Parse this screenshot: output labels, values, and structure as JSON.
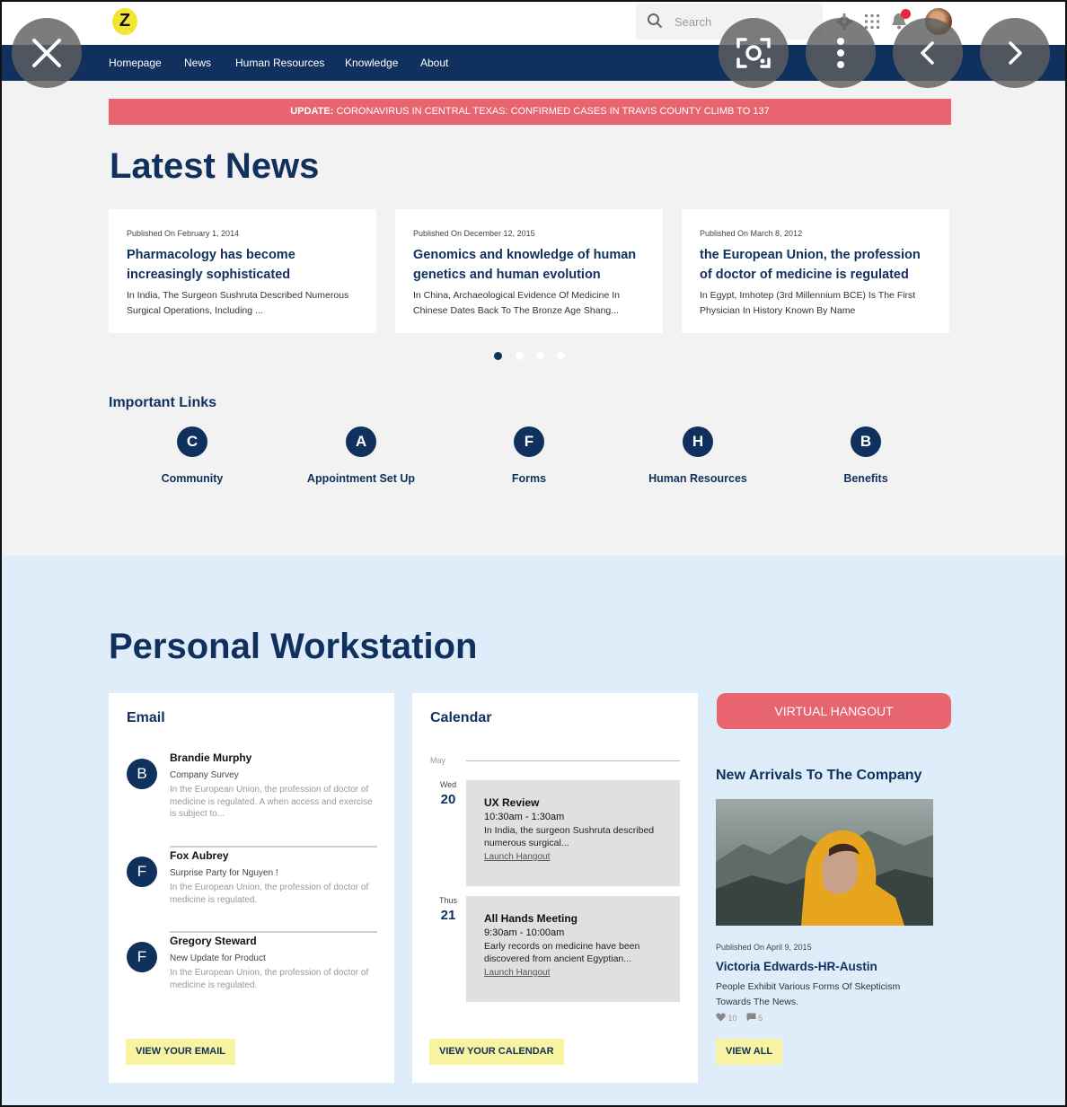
{
  "header": {
    "logo_letter": "Z",
    "search_placeholder": "Search",
    "icons": [
      "search-icon",
      "gear-icon",
      "apps-grid-icon",
      "bell-icon",
      "avatar"
    ]
  },
  "nav": {
    "items": [
      "Homepage",
      "News",
      "Human Resources",
      "Knowledge",
      "About"
    ]
  },
  "viewer_controls": [
    "close-icon",
    "lens-icon",
    "more-vertical-icon",
    "chevron-left-icon",
    "chevron-right-icon"
  ],
  "alert": {
    "label": "UPDATE:",
    "text": "CORONAVIRUS IN CENTRAL TEXAS: CONFIRMED CASES IN TRAVIS COUNTY CLIMB TO 137"
  },
  "latest_news": {
    "heading": "Latest News",
    "cards": [
      {
        "date": "Published On February 1, 2014",
        "title": "Pharmacology has become increasingly sophisticated",
        "excerpt": "In India, The Surgeon Sushruta Described Numerous Surgical Operations, Including ..."
      },
      {
        "date": "Published On December 12, 2015",
        "title": "Genomics and knowledge of human genetics and human evolution",
        "excerpt": "In China, Archaeological Evidence Of Medicine In Chinese Dates Back To The Bronze Age Shang..."
      },
      {
        "date": "Published On March 8, 2012",
        "title": "the European Union, the profession of doctor of medicine is regulated",
        "excerpt": "In Egypt, Imhotep (3rd Millennium BCE) Is The First Physician In History Known By Name"
      }
    ],
    "carousel_active": 1,
    "carousel_total": 4
  },
  "important_links": {
    "heading": "Important Links",
    "items": [
      {
        "letter": "C",
        "label": "Community"
      },
      {
        "letter": "A",
        "label": "Appointment Set Up"
      },
      {
        "letter": "F",
        "label": "Forms"
      },
      {
        "letter": "H",
        "label": "Human Resources"
      },
      {
        "letter": "B",
        "label": "Benefits"
      }
    ]
  },
  "workstation": {
    "heading": "Personal Workstation",
    "email": {
      "title": "Email",
      "messages": [
        {
          "initial": "B",
          "from": "Brandie Murphy",
          "subject": "Company Survey",
          "preview": "In the European Union, the profession of doctor of medicine is regulated. A  when access and exercise is subject to..."
        },
        {
          "initial": "F",
          "from": "Fox Aubrey",
          "subject": "Surprise Party for Nguyen !",
          "preview": "In the European Union, the profession of doctor of medicine is regulated."
        },
        {
          "initial": "F",
          "from": "Gregory Steward",
          "subject": "New Update for Product",
          "preview": "In the European Union, the profession of doctor of medicine is regulated."
        }
      ],
      "cta": "VIEW YOUR EMAIL"
    },
    "calendar": {
      "title": "Calendar",
      "month": "May",
      "days": [
        {
          "dow": "Wed",
          "num": "20",
          "event": {
            "title": "UX Review",
            "time": "10:30am - 1:30am",
            "desc": "In India, the surgeon Sushruta described numerous surgical...",
            "link": "Launch Hangout"
          }
        },
        {
          "dow": "Thus",
          "num": "21",
          "event": {
            "title": "All Hands Meeting",
            "time": "9:30am - 10:00am",
            "desc": "Early records on medicine have been discovered from ancient Egyptian...",
            "link": "Launch Hangout"
          }
        }
      ],
      "cta": "VIEW YOUR CALENDAR"
    },
    "side": {
      "hangout_label": "VIRTUAL HANGOUT",
      "arrivals_title": "New Arrivals To The Company",
      "photo_name": "new-arrival-photo",
      "date": "Published On April 9, 2015",
      "name": "Victoria Edwards-HR-Austin",
      "desc": "People Exhibit Various Forms Of Skepticism Towards The News.",
      "likes": "10",
      "comments": "5",
      "cta": "VIEW ALL"
    }
  },
  "colors": {
    "navy": "#10305e",
    "alert": "#e8646f",
    "cta_yellow": "#f8f3a0",
    "workstation_bg": "#dfedfa",
    "page_bg": "#f2f2f2"
  }
}
